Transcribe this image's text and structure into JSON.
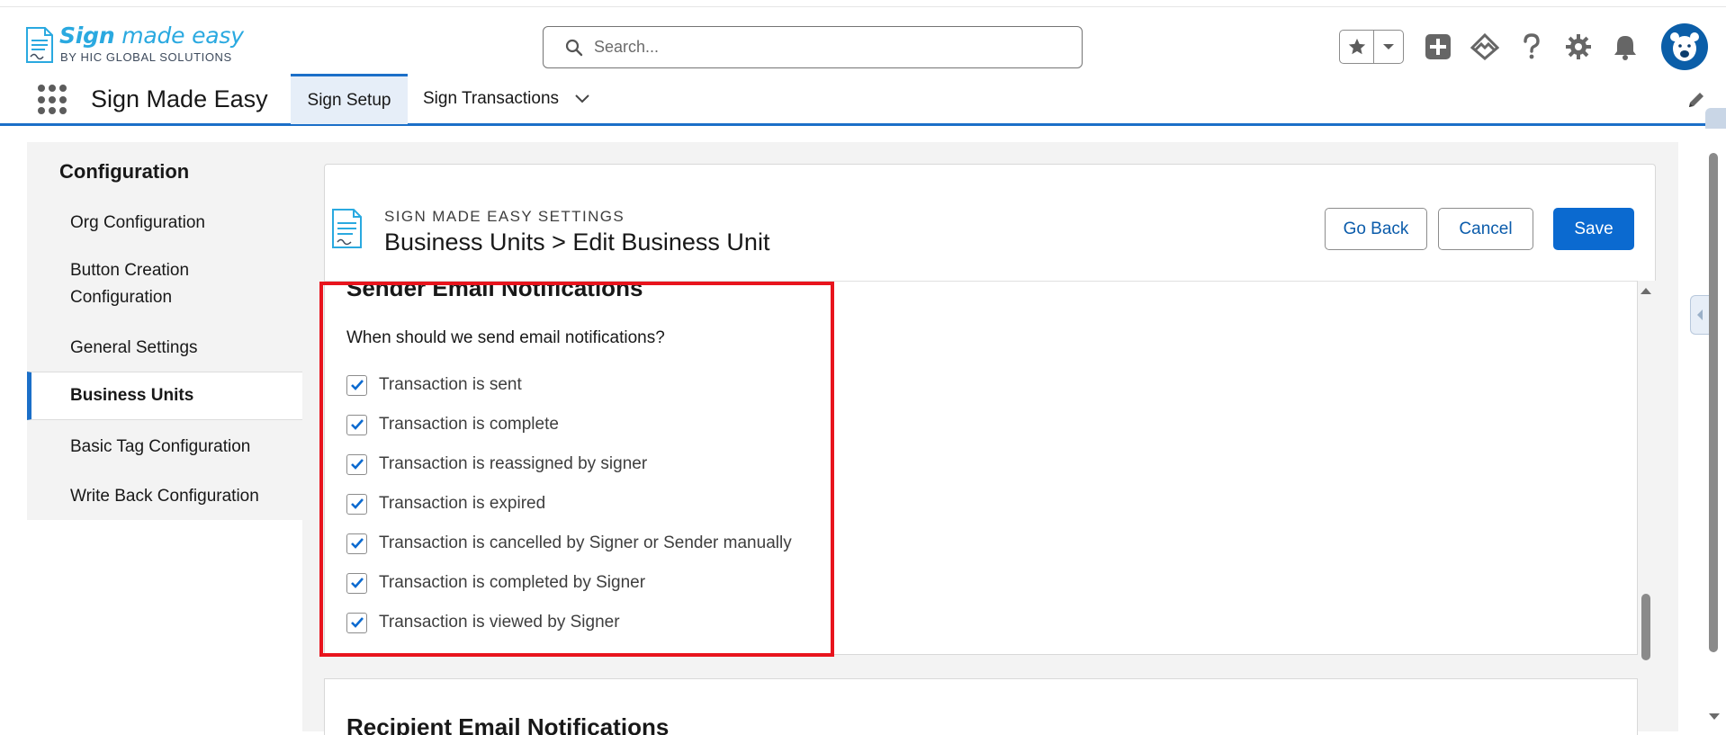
{
  "brand": {
    "logo_title_bold": "Sign",
    "logo_title_light": " made easy",
    "logo_sub": "BY HIC GLOBAL SOLUTIONS"
  },
  "header": {
    "search_placeholder": "Search...",
    "icons": [
      "favorites-star-icon",
      "favorites-dropdown-icon",
      "global-add-icon",
      "trailhead-icon",
      "help-icon",
      "setup-gear-icon",
      "notifications-bell-icon",
      "user-avatar"
    ]
  },
  "app_nav": {
    "app_name": "Sign Made Easy",
    "tabs": [
      {
        "label": "Sign Setup",
        "active": true
      },
      {
        "label": "Sign Transactions",
        "active": false
      }
    ]
  },
  "sidebar": {
    "title": "Configuration",
    "items": [
      {
        "label": "Org Configuration",
        "active": false
      },
      {
        "label": "Button Creation Configuration",
        "active": false
      },
      {
        "label": "General Settings",
        "active": false
      },
      {
        "label": "Business Units",
        "active": true
      },
      {
        "label": "Basic Tag Configuration",
        "active": false
      },
      {
        "label": "Write Back Configuration",
        "active": false
      }
    ]
  },
  "card_header": {
    "eyebrow": "SIGN MADE EASY SETTINGS",
    "title": "Business Units > Edit Business Unit",
    "go_back": "Go Back",
    "cancel": "Cancel",
    "save": "Save"
  },
  "sender_section": {
    "title": "Sender Email Notifications",
    "question": "When should we send email notifications?",
    "options": [
      {
        "label": "Transaction is sent",
        "checked": true
      },
      {
        "label": "Transaction is complete",
        "checked": true
      },
      {
        "label": "Transaction is reassigned by signer",
        "checked": true
      },
      {
        "label": "Transaction is expired",
        "checked": true
      },
      {
        "label": "Transaction is cancelled by Signer or Sender manually",
        "checked": true
      },
      {
        "label": "Transaction is completed by Signer",
        "checked": true
      },
      {
        "label": "Transaction is viewed by Signer",
        "checked": true
      }
    ]
  },
  "recipient_section": {
    "title": "Recipient Email Notifications"
  },
  "colors": {
    "brand_blue": "#1b6fc8",
    "save_button": "#0b6ad0",
    "highlight_red": "#e8141d",
    "logo_cyan": "#2aa9e0"
  }
}
